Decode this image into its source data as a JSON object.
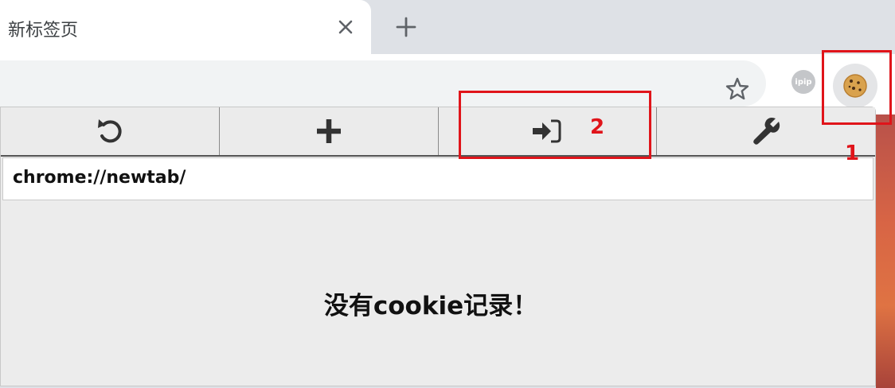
{
  "tab": {
    "title": "新标签页"
  },
  "popup": {
    "url": "chrome://newtab/",
    "empty_message": "没有cookie记录！"
  },
  "extensions": {
    "ipip_label": "ipip"
  },
  "annotations": {
    "box1_number": "1",
    "box2_number": "2",
    "color": "#e0141a"
  },
  "icons": [
    "close-icon",
    "plus-icon",
    "star-icon",
    "ipip-icon",
    "cookie-icon",
    "refresh-icon",
    "add-icon",
    "import-icon",
    "wrench-icon"
  ]
}
